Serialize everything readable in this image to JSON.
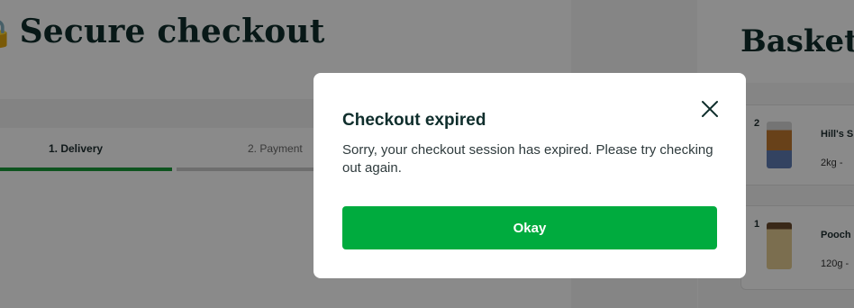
{
  "checkout": {
    "title": "Secure checkout",
    "steps": [
      {
        "label": "1. Delivery"
      },
      {
        "label": "2. Payment"
      }
    ]
  },
  "basket": {
    "title": "Basket",
    "items": [
      {
        "qty": "2",
        "name": "Hill's S",
        "size": "2kg",
        "separator": "-"
      },
      {
        "qty": "1",
        "name": "Pooch",
        "size": "120g",
        "separator": "-"
      }
    ]
  },
  "modal": {
    "title": "Checkout expired",
    "message": "Sorry, your checkout session has expired. Please try checking out again.",
    "button_label": "Okay",
    "close_icon": "close-icon"
  },
  "colors": {
    "primary_button": "#00ab3e",
    "step_active": "#1a9a3a",
    "heading": "#0f2e2c"
  }
}
